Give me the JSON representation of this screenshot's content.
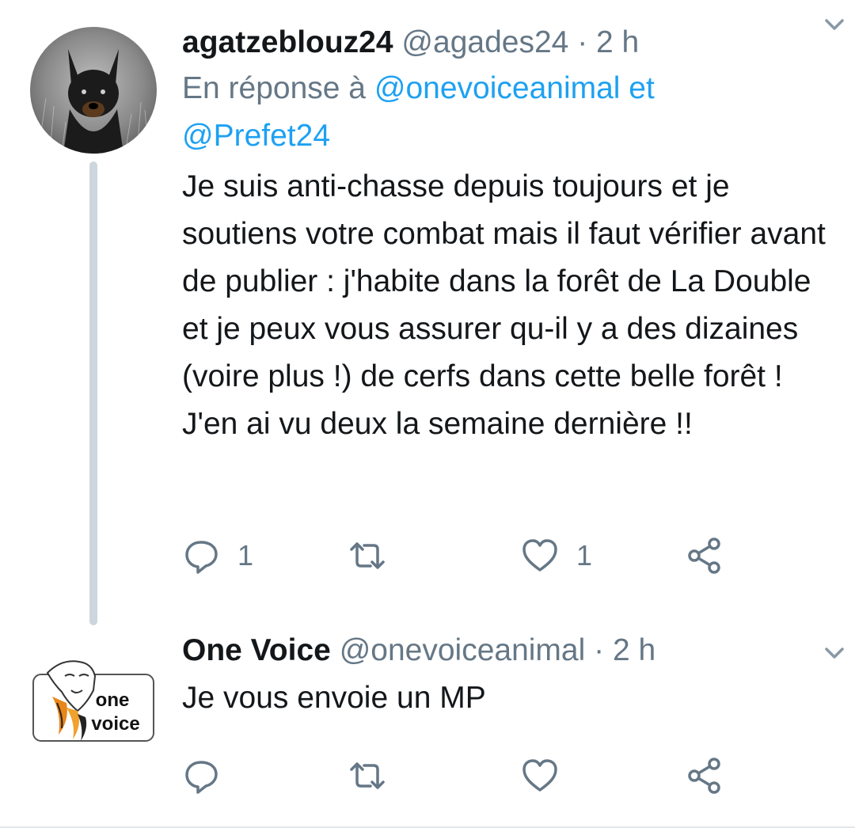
{
  "tweets": [
    {
      "name": "agatzeblouz24",
      "handle": "@agades24",
      "separator": "·",
      "time": "2 h",
      "reply_prefix": "En réponse à",
      "reply_mention_1": "@onevoiceanimal",
      "reply_conjunction": "et",
      "reply_mention_2": "@Prefet24",
      "text": "Je suis anti-chasse depuis toujours et je soutiens votre combat mais il faut vérifier avant de publier : j'habite dans la forêt de La Double et je peux vous assurer qu-il y a des dizaines (voire plus !) de cerfs dans cette belle forêt ! J'en ai vu deux la semaine dernière !!",
      "reply_count": "1",
      "retweet_count": "",
      "like_count": "1"
    },
    {
      "name": "One Voice",
      "handle": "@onevoiceanimal",
      "separator": "·",
      "time": "2 h",
      "text": "Je vous envoie un MP",
      "logo_line1": "one",
      "logo_line2": "voice",
      "reply_count": "",
      "retweet_count": "",
      "like_count": ""
    }
  ],
  "icons": {
    "reply": "reply-icon",
    "retweet": "retweet-icon",
    "like": "heart-icon",
    "share": "share-icon",
    "more": "chevron-down-icon"
  },
  "colors": {
    "text": "#14171a",
    "muted": "#657786",
    "link": "#1da1f2",
    "thread_line": "#ccd6dd",
    "logo_orange": "#e8861a"
  }
}
